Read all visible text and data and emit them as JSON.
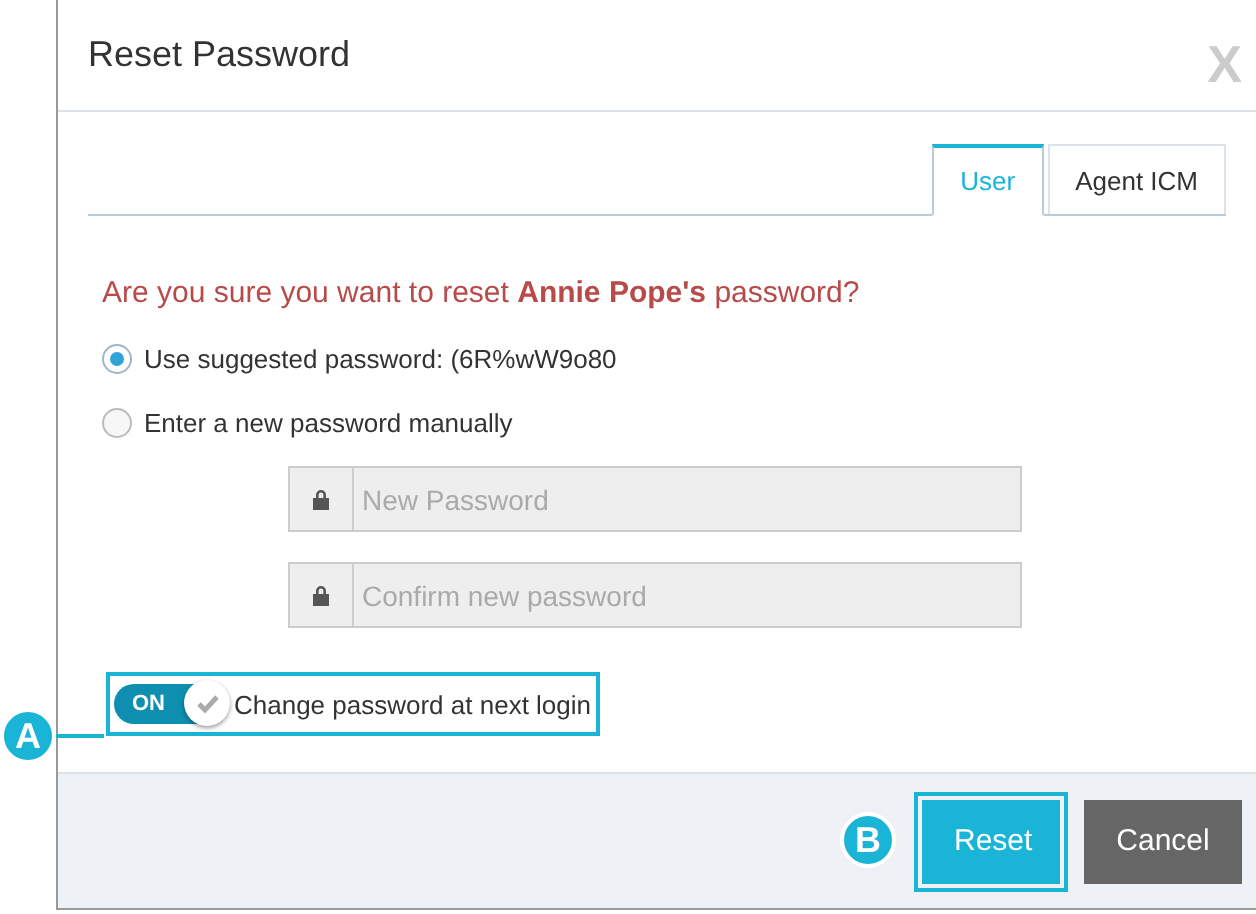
{
  "dialog": {
    "title": "Reset Password",
    "close": "X"
  },
  "tabs": [
    {
      "label": "User",
      "selected": true
    },
    {
      "label": "Agent ICM",
      "selected": false
    }
  ],
  "question": "Are you sure you want to reset **Annie Pope's** password?",
  "options": [
    {
      "label": "Use suggested password: (6R%wW9o80",
      "selected": true
    },
    {
      "label": "Enter a new password manually",
      "selected": false
    }
  ],
  "fields": [
    {
      "placeholder": "New Password"
    },
    {
      "placeholder": "Confirm new password"
    }
  ],
  "toggle": {
    "on": true,
    "state_label": "ON",
    "label": "Change password at next login"
  },
  "buttons": [
    {
      "label": "Reset",
      "kind": "primary"
    },
    {
      "label": "Cancel",
      "kind": "secondary"
    }
  ],
  "callouts": [
    "A",
    "B"
  ]
}
